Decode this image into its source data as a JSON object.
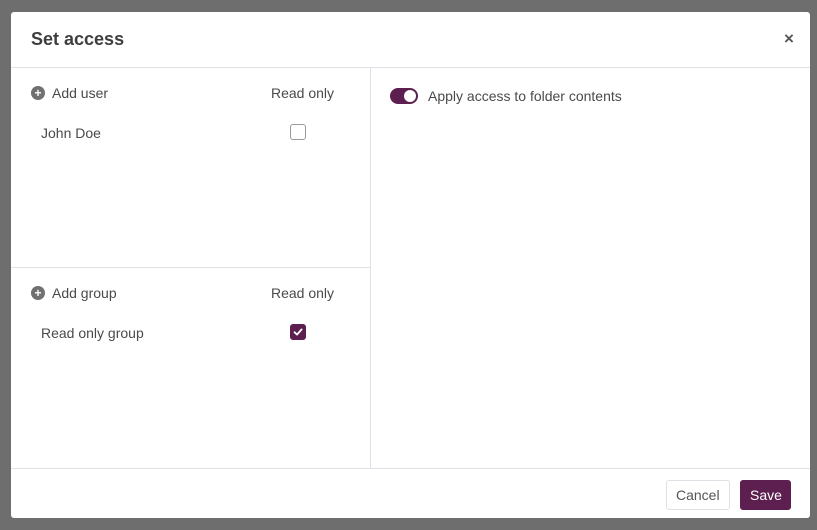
{
  "dialog": {
    "title": "Set access",
    "close_glyph": "×"
  },
  "users_section": {
    "add_label": "Add user",
    "add_icon": "plus-circle-icon",
    "column_header": "Read only",
    "rows": [
      {
        "name": "John Doe",
        "read_only": false
      }
    ]
  },
  "groups_section": {
    "add_label": "Add group",
    "add_icon": "plus-circle-icon",
    "column_header": "Read only",
    "rows": [
      {
        "name": "Read only group",
        "read_only": true
      }
    ]
  },
  "options": {
    "apply_to_contents_label": "Apply access to folder contents",
    "apply_to_contents_enabled": true
  },
  "footer": {
    "cancel_label": "Cancel",
    "save_label": "Save"
  },
  "colors": {
    "accent": "#5d1f4f",
    "backdrop": "#6e6e6e"
  }
}
